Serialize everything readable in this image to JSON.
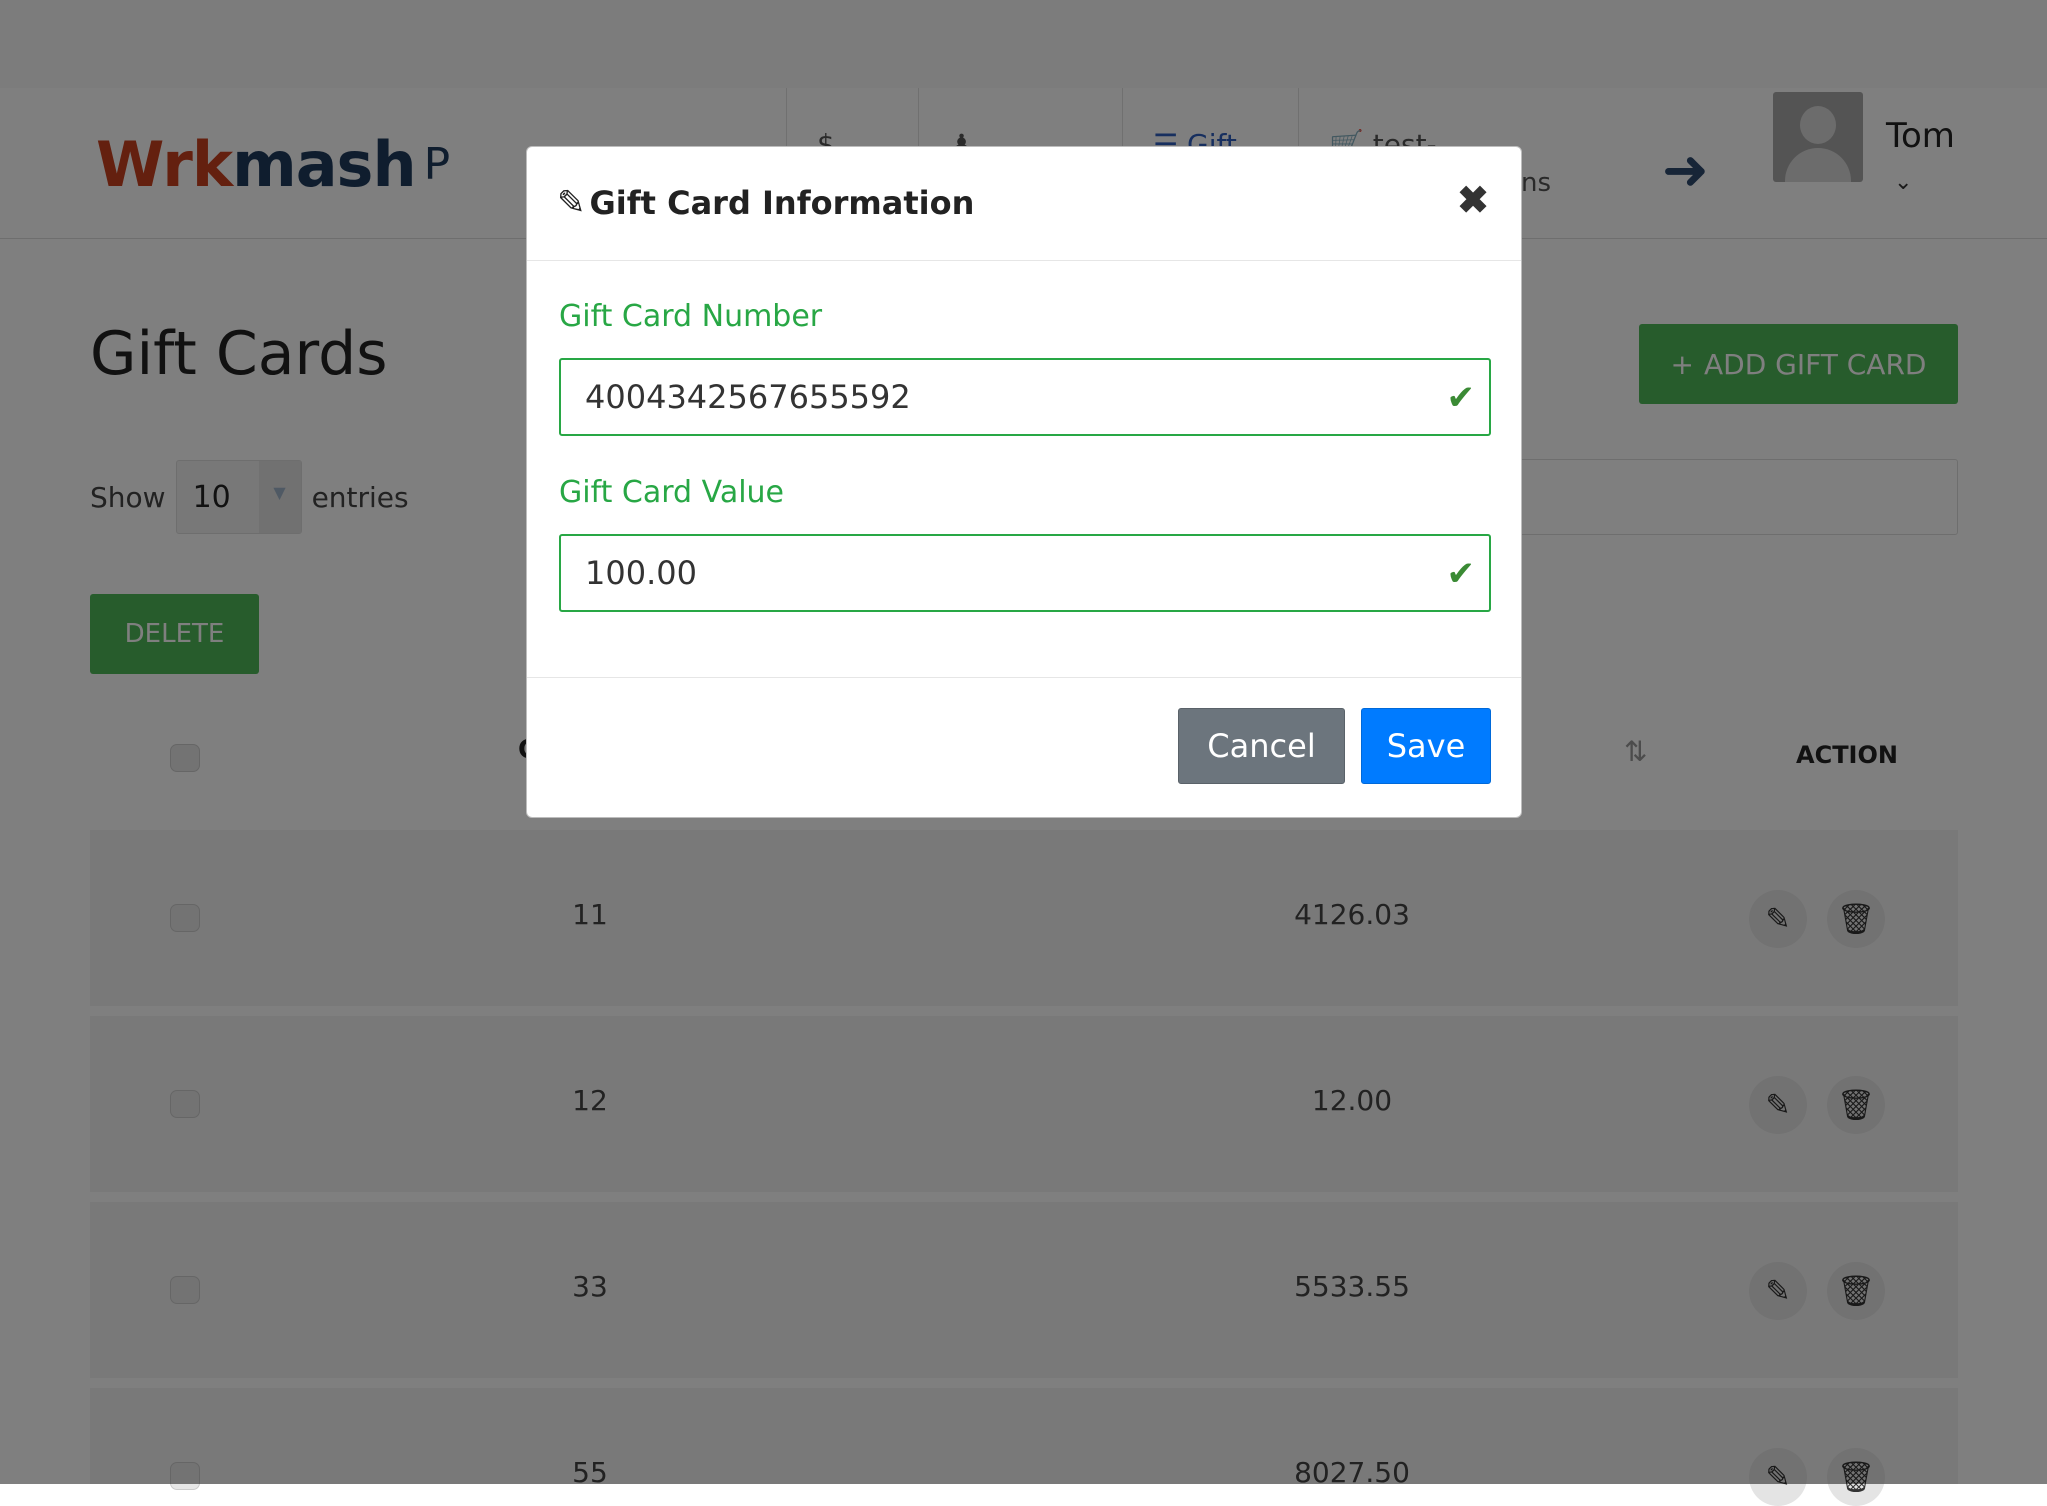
{
  "header": {
    "logo": {
      "part1": "Wrk",
      "part2": "mash",
      "extra": "P"
    },
    "nav": [
      {
        "icon": "$",
        "label": ""
      },
      {
        "icon": "♟",
        "label": ""
      },
      {
        "icon": "☰",
        "label": "Gift"
      },
      {
        "icon": "🛒",
        "label": "test-"
      }
    ],
    "nav_overflow_text": "ns",
    "user_name": "Tom",
    "user_chevron": "⌄"
  },
  "page": {
    "title": "Gift Cards",
    "add_button_label": "ADD GIFT CARD",
    "add_button_icon": "+",
    "show_label": "Show",
    "entries_label": "entries",
    "page_length": "10",
    "delete_button_label": "DELETE",
    "table_headers": {
      "col_c": "C",
      "action": "ACTION"
    }
  },
  "table_rows": [
    {
      "id": "11",
      "value": "4126.03"
    },
    {
      "id": "12",
      "value": "12.00"
    },
    {
      "id": "33",
      "value": "5533.55"
    },
    {
      "id": "55",
      "value": "8027.50"
    }
  ],
  "modal": {
    "title": "Gift Card Information",
    "number_label": "Gift Card Number",
    "number_value": "4004342567655592",
    "value_label": "Gift Card Value",
    "value_value": "100.00",
    "cancel_label": "Cancel",
    "save_label": "Save",
    "close_glyph": "✖"
  },
  "colors": {
    "accent_green": "#4fb858",
    "valid_green": "#28a745",
    "primary_blue": "#007bff",
    "cancel_gray": "#6c757d",
    "logo_red": "#c8401e",
    "logo_navy": "#1f3a5c"
  }
}
